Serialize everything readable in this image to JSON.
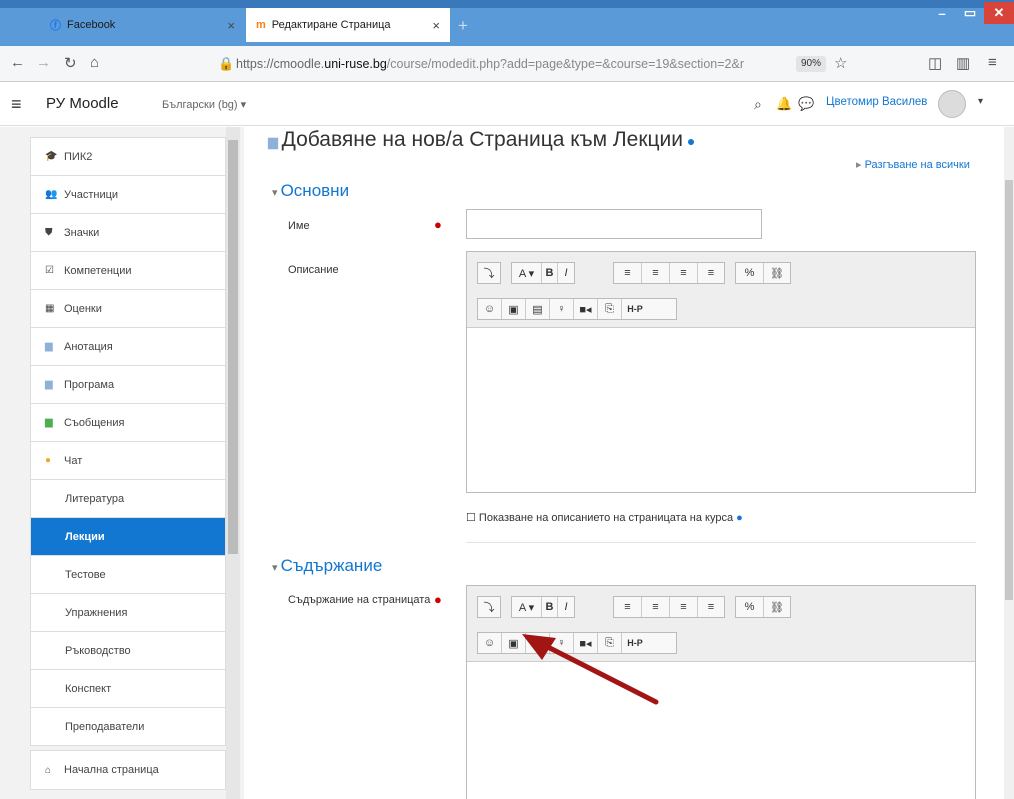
{
  "browser": {
    "tabs": [
      {
        "label": "Facebook",
        "icon": "facebook-icon"
      },
      {
        "label": "Редактиране Страница",
        "icon": "moodle-icon"
      }
    ],
    "url_prefix": "https://cmoodle.",
    "url_domain": "uni-ruse.bg",
    "url_rest": "/course/modedit.php?add=page&type=&course=19&section=2&r",
    "zoom": "90%"
  },
  "header": {
    "site_name": "РУ Moodle",
    "language": "Български (bg) ▾",
    "user_name": "Цветомир Василев"
  },
  "sidebar": {
    "items": [
      {
        "label": "ПИК2",
        "icon": "graduation-cap-icon"
      },
      {
        "label": "Участници",
        "icon": "users-icon"
      },
      {
        "label": "Значки",
        "icon": "badge-icon"
      },
      {
        "label": "Компетенции",
        "icon": "checkbox-icon"
      },
      {
        "label": "Оценки",
        "icon": "table-icon"
      },
      {
        "label": "Анотация",
        "icon": "file-icon"
      },
      {
        "label": "Програма",
        "icon": "file-icon"
      },
      {
        "label": "Съобщения",
        "icon": "forum-icon"
      },
      {
        "label": "Чат",
        "icon": "chat-icon"
      },
      {
        "label": "Литература"
      },
      {
        "label": "Лекции",
        "active": true
      },
      {
        "label": "Тестове"
      },
      {
        "label": "Упражнения"
      },
      {
        "label": "Ръководство"
      },
      {
        "label": "Конспект"
      },
      {
        "label": "Преподаватели"
      }
    ],
    "home": {
      "label": "Начална страница",
      "icon": "home-icon"
    }
  },
  "main": {
    "title": "Добавяне на нов/а Страница към Лекции",
    "expand_all": "Разгъване на всички",
    "sections": [
      {
        "label": "Основни"
      },
      {
        "label": "Съдържание"
      }
    ],
    "fields": {
      "name_label": "Име",
      "description_label": "Описание",
      "show_description": "Показване на описанието на страницата на курса",
      "content_label": "Съдържание на страницата"
    }
  },
  "editor_toolbar": {
    "row1": [
      "⤵",
      "A ▾",
      "B",
      "I",
      "≡",
      "≡",
      "≡",
      "≡",
      "%",
      "⛓"
    ],
    "row2": [
      "☺",
      "▣",
      "▤",
      "♀",
      "■◂",
      "⎘",
      "H-P"
    ]
  },
  "colors": {
    "accent": "#1177d1",
    "browser_chrome": "#5a9ad8",
    "required": "#cc0000",
    "arrow": "#a31515"
  }
}
